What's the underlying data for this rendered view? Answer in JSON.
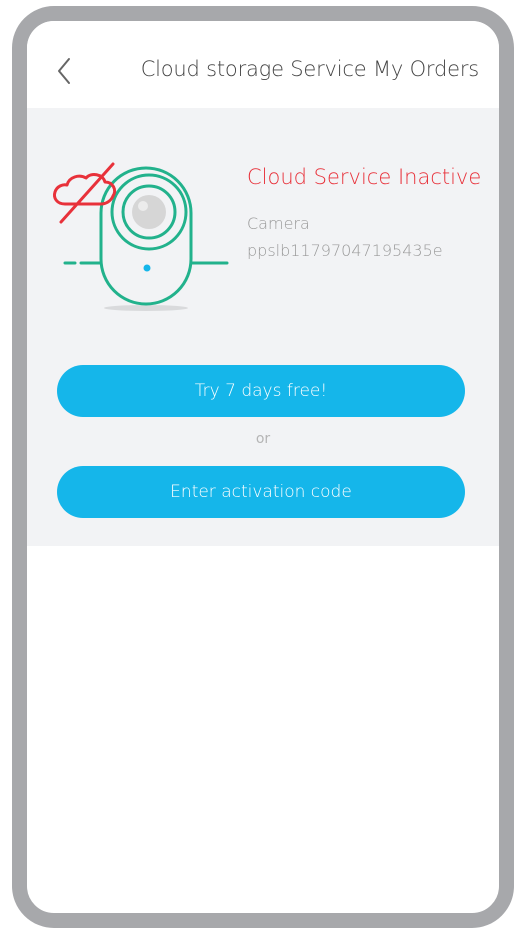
{
  "header": {
    "title": "Cloud storage Service My Orders",
    "back_icon": "chevron-left-icon"
  },
  "status": {
    "text": "Cloud Service Inactive",
    "color": "#e8313a",
    "icon": "cloud-disabled-icon"
  },
  "device": {
    "label": "Camera",
    "id": "ppslb11797047195435e"
  },
  "actions": {
    "trial_label": "Try 7 days free!",
    "separator": "or",
    "activation_label": "Enter activation code"
  },
  "colors": {
    "accent": "#15b6ea",
    "camera": "#22b28c",
    "panel_bg": "#f2f3f5",
    "frame": "#a7a8ab"
  }
}
